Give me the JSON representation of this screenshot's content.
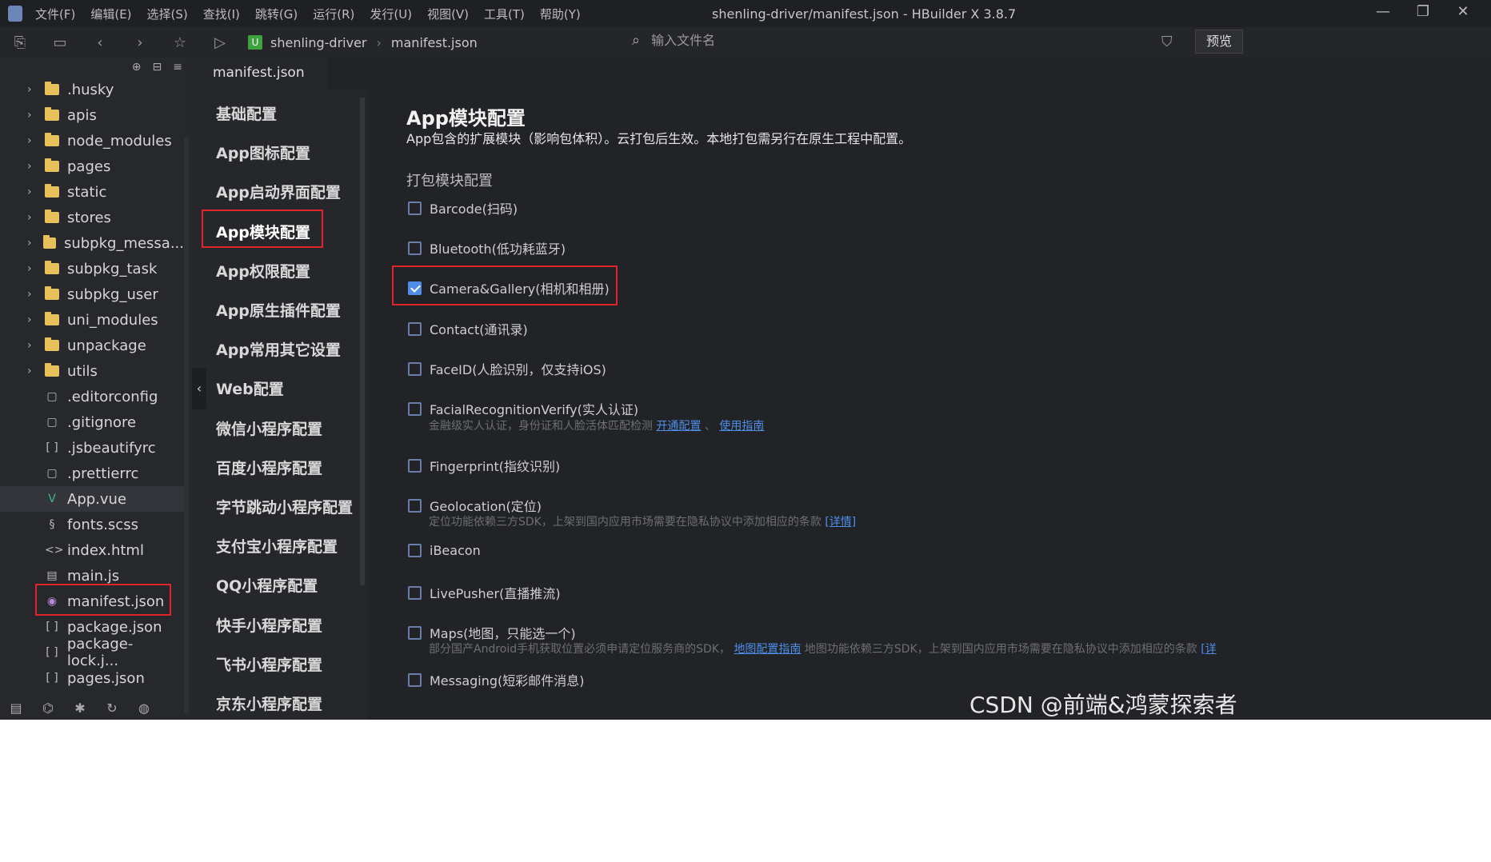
{
  "menu": {
    "items": [
      "文件(F)",
      "编辑(E)",
      "选择(S)",
      "查找(I)",
      "跳转(G)",
      "运行(R)",
      "发行(U)",
      "视图(V)",
      "工具(T)",
      "帮助(Y)"
    ],
    "window_title": "shenling-driver/manifest.json - HBuilder X 3.8.7",
    "window_controls": [
      "—",
      "❐",
      "✕"
    ]
  },
  "toolbar": {
    "breadcrumb": [
      "shenling-driver",
      "manifest.json"
    ],
    "project_badge": "U",
    "search_placeholder": "输入文件名",
    "preview_label": "预览"
  },
  "tree": {
    "items": [
      {
        "label": ".husky",
        "type": "folder"
      },
      {
        "label": "apis",
        "type": "folder"
      },
      {
        "label": "node_modules",
        "type": "folder"
      },
      {
        "label": "pages",
        "type": "folder"
      },
      {
        "label": "static",
        "type": "folder"
      },
      {
        "label": "stores",
        "type": "folder"
      },
      {
        "label": "subpkg_messa...",
        "type": "folder"
      },
      {
        "label": "subpkg_task",
        "type": "folder"
      },
      {
        "label": "subpkg_user",
        "type": "folder"
      },
      {
        "label": "uni_modules",
        "type": "folder"
      },
      {
        "label": "unpackage",
        "type": "folder"
      },
      {
        "label": "utils",
        "type": "folder"
      },
      {
        "label": ".editorconfig",
        "type": "file"
      },
      {
        "label": ".gitignore",
        "type": "file"
      },
      {
        "label": ".jsbeautifyrc",
        "type": "json"
      },
      {
        "label": ".prettierrc",
        "type": "file"
      },
      {
        "label": "App.vue",
        "type": "vue"
      },
      {
        "label": "fonts.scss",
        "type": "scss"
      },
      {
        "label": "index.html",
        "type": "html"
      },
      {
        "label": "main.js",
        "type": "js"
      },
      {
        "label": "manifest.json",
        "type": "manifest"
      },
      {
        "label": "package.json",
        "type": "json"
      },
      {
        "label": "package-lock.j...",
        "type": "json"
      },
      {
        "label": "pages.json",
        "type": "json"
      }
    ]
  },
  "editor": {
    "tab": "manifest.json"
  },
  "config_nav": {
    "items": [
      "基础配置",
      "App图标配置",
      "App启动界面配置",
      "App模块配置",
      "App权限配置",
      "App原生插件配置",
      "App常用其它设置",
      "Web配置",
      "微信小程序配置",
      "百度小程序配置",
      "字节跳动小程序配置",
      "支付宝小程序配置",
      "QQ小程序配置",
      "快手小程序配置",
      "飞书小程序配置",
      "京东小程序配置"
    ],
    "active": "App模块配置"
  },
  "content": {
    "title": "App模块配置",
    "desc": "App包含的扩展模块（影响包体积）。云打包后生效。本地打包需另行在原生工程中配置。",
    "section": "打包模块配置",
    "options": [
      {
        "label": "Barcode(扫码)",
        "checked": false
      },
      {
        "label": "Bluetooth(低功耗蓝牙)",
        "checked": false
      },
      {
        "label": "Camera&Gallery(相机和相册)",
        "checked": true
      },
      {
        "label": "Contact(通讯录)",
        "checked": false
      },
      {
        "label": "FaceID(人脸识别，仅支持iOS)",
        "checked": false
      },
      {
        "label": "FacialRecognitionVerify(实人认证)",
        "checked": false
      },
      {
        "label": "Fingerprint(指纹识别)",
        "checked": false
      },
      {
        "label": "Geolocation(定位)",
        "checked": false
      },
      {
        "label": "iBeacon",
        "checked": false
      },
      {
        "label": "LivePusher(直播推流)",
        "checked": false
      },
      {
        "label": "Maps(地图，只能选一个)",
        "checked": false
      },
      {
        "label": "Messaging(短彩邮件消息)",
        "checked": false
      }
    ],
    "notes": {
      "facial_text": "金融级实人认证，身份证和人脸活体匹配检测",
      "facial_link1": "开通配置",
      "facial_link2": "使用指南",
      "geo_text": "定位功能依赖三方SDK，上架到国内应用市场需要在隐私协议中添加相应的条款",
      "geo_link": "[详情]",
      "maps_text1": "部分国产Android手机获取位置必须申请定位服务商的SDK，",
      "maps_link": "地图配置指南",
      "maps_text2": " 地图功能依赖三方SDK，上架到国内应用市场需要在隐私协议中添加相应的条款",
      "maps_link2": "[详"
    }
  },
  "watermark": "CSDN @前端&鸿蒙探索者",
  "colors": {
    "accent": "#4f8de8",
    "highlight": "#e0242b",
    "folder": "#e6c15a"
  }
}
